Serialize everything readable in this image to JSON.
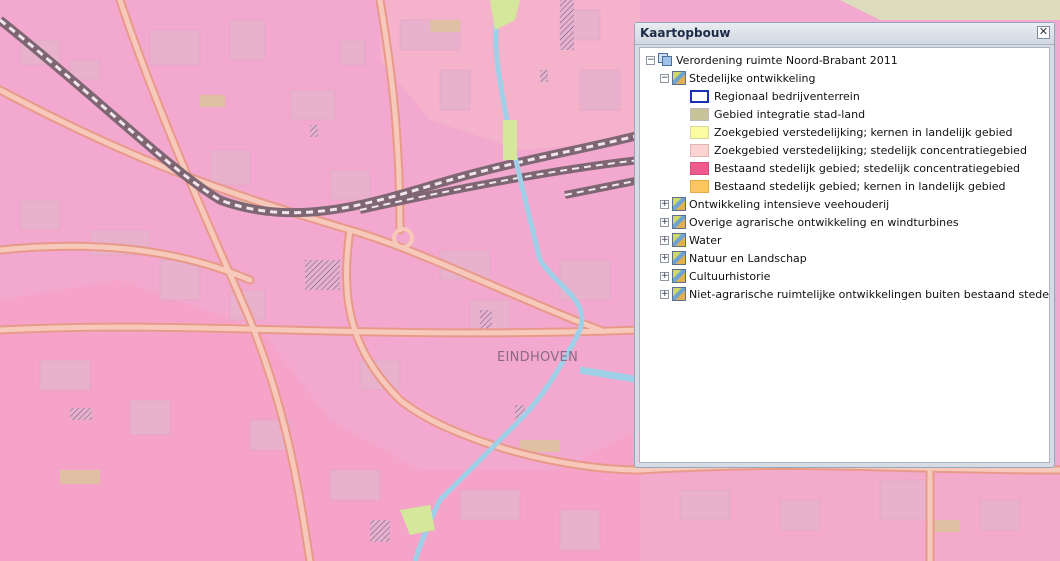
{
  "map": {
    "city_label": "EINDHOVEN",
    "colors": {
      "urban_concentration": "#f3a8cf",
      "urban_core": "#f5a6c8",
      "road_casing": "#e89a8a",
      "road": "#f7c6b7",
      "building": "#e9b1cb",
      "water": "#aed6e8",
      "green": "#d4e79b",
      "rail": "#8a6f7b"
    }
  },
  "panel": {
    "title": "Kaartopbouw",
    "close_icon": "close-icon",
    "tree": {
      "root": {
        "label": "Verordening ruimte Noord-Brabant 2011",
        "expander": "⊟",
        "icon": "layer-group-icon"
      },
      "groups": [
        {
          "label": "Stedelijke ontwikkeling",
          "expander": "⊟",
          "expanded": true,
          "legend": [
            {
              "label": "Regionaal bedrijventerrein",
              "fill": "#ffffff",
              "border": "#1a2fb8"
            },
            {
              "label": "Gebied integratie stad-land",
              "fill": "#c9c39a",
              "border": "#bcbcbc"
            },
            {
              "label": "Zoekgebied verstedelijking; kernen in landelijk gebied",
              "fill": "#fbfba0",
              "border": "#d6d6a0"
            },
            {
              "label": "Zoekgebied verstedelijking; stedelijk concentratiegebied",
              "fill": "#fbd3d3",
              "border": "#e2b5b5"
            },
            {
              "label": "Bestaand stedelijk gebied; stedelijk concentratiegebied",
              "fill": "#f05a8f",
              "border": "#d94a7c"
            },
            {
              "label": "Bestaand stedelijk gebied; kernen in landelijk gebied",
              "fill": "#fbc65e",
              "border": "#e6a94a"
            }
          ]
        },
        {
          "label": "Ontwikkeling intensieve veehouderij",
          "expander": "⊞",
          "expanded": false
        },
        {
          "label": "Overige agrarische ontwikkeling en windturbines",
          "expander": "⊞",
          "expanded": false
        },
        {
          "label": "Water",
          "expander": "⊞",
          "expanded": false
        },
        {
          "label": "Natuur en Landschap",
          "expander": "⊞",
          "expanded": false
        },
        {
          "label": "Cultuurhistorie",
          "expander": "⊞",
          "expanded": false
        },
        {
          "label": "Niet-agrarische ruimtelijke ontwikkelingen buiten bestaand stedelijk gebied",
          "expander": "⊞",
          "expanded": false
        }
      ]
    }
  }
}
